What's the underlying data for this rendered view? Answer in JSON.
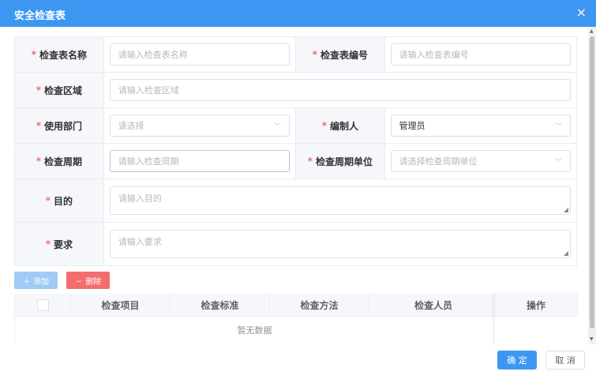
{
  "dialog": {
    "title": "安全检查表",
    "close_glyph": "×"
  },
  "form": {
    "name_label": "检查表名称",
    "name_placeholder": "请输入检查表名称",
    "code_label": "检查表编号",
    "code_placeholder": "请输入检查表编号",
    "area_label": "检查区域",
    "area_placeholder": "请输入检查区域",
    "dept_label": "使用部门",
    "dept_placeholder": "请选择",
    "author_label": "编制人",
    "author_value": "管理员",
    "period_label": "检查周期",
    "period_placeholder": "请输入检查周期",
    "unit_label": "检查周期单位",
    "unit_placeholder": "请选择检查周期单位",
    "purpose_label": "目的",
    "purpose_placeholder": "请输入目的",
    "req_label": "要求",
    "req_placeholder": "请输入要求"
  },
  "actions": {
    "add": "＋ 添加",
    "delete": "－ 删除"
  },
  "grid": {
    "columns": [
      "检查项目",
      "检查标准",
      "检查方法",
      "检查人员"
    ],
    "action_col": "操作",
    "empty_text": "暂无数据"
  },
  "footer": {
    "ok": "确 定",
    "cancel": "取 消"
  },
  "colors": {
    "primary": "#3d97f2",
    "danger": "#f36d6d",
    "required": "#f56c6c"
  }
}
